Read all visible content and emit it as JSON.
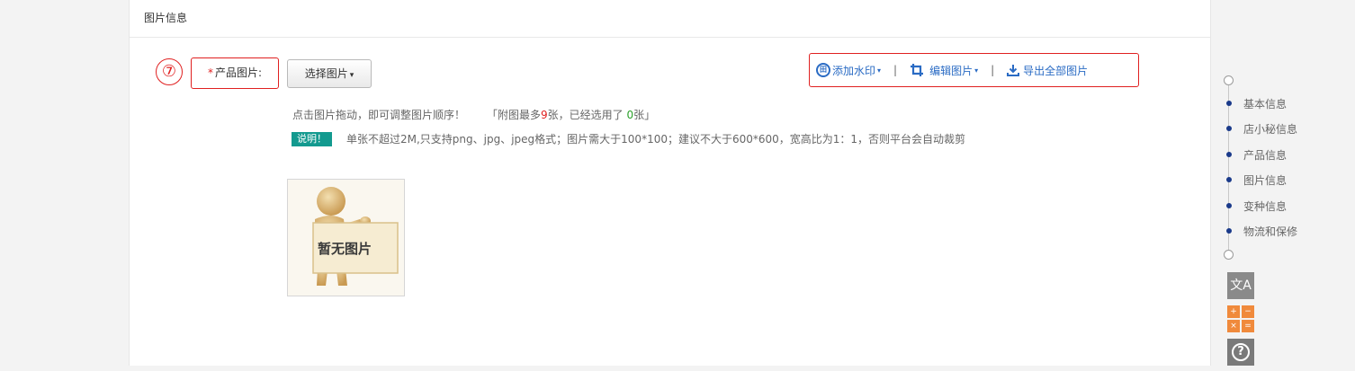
{
  "section": {
    "title": "图片信息"
  },
  "annotations": {
    "step_number": "⑦"
  },
  "product_image": {
    "required_mark": "*",
    "label": "产品图片:",
    "select_button_label": "选择图片",
    "select_button_caret": "▾"
  },
  "toolbar": {
    "watermark_label": "添加水印",
    "edit_label": "编辑图片",
    "export_label": "导出全部图片",
    "caret": "▾",
    "separator": "|"
  },
  "hints": {
    "drag_tip": "点击图片拖动，即可调整图片顺序！",
    "count_prefix": "「附图最多",
    "max_count": "9",
    "count_middle": "张，已经选用了 ",
    "used_count": "0",
    "count_suffix": "张」",
    "note_badge": "说明！",
    "note_text": "单张不超过2M,只支持png、jpg、jpeg格式；图片需大于100*100；建议不大于600*600，宽高比为1：1，否则平台会自动裁剪"
  },
  "placeholder": {
    "text": "暂无图片"
  },
  "side_nav": {
    "items": [
      "基本信息",
      "店小秘信息",
      "产品信息",
      "图片信息",
      "变种信息",
      "物流和保修"
    ]
  },
  "tools": {
    "translate_glyph": "文A",
    "calc_glyphs": [
      "+",
      "−",
      "×",
      "="
    ],
    "help_glyph": "?"
  },
  "colors": {
    "accent_red": "#e02020",
    "link_blue": "#2a6bc4",
    "badge_teal": "#139a8f",
    "nav_dot": "#1a3a8a",
    "calc_orange": "#f08a3c"
  }
}
